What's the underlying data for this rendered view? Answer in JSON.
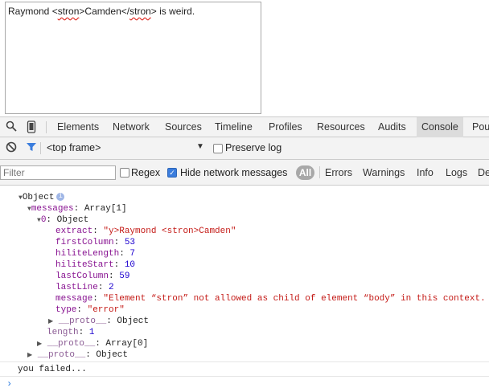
{
  "page": {
    "textarea": {
      "before": "Raymond <",
      "w1": "stron",
      "mid": ">Camden</",
      "w2": "stron",
      "after": "> is weird."
    }
  },
  "devtools": {
    "tabs": [
      "Elements",
      "Network",
      "Sources",
      "Timeline",
      "Profiles",
      "Resources",
      "Audits",
      "Console",
      "Pou"
    ],
    "active_tab": "Console",
    "frame": "<top frame>",
    "preserve_log": "Preserve log",
    "filter_placeholder": "Filter",
    "regex": "Regex",
    "hide_network": "Hide network messages",
    "levels": [
      "All",
      "Errors",
      "Warnings",
      "Info",
      "Logs",
      "De"
    ]
  },
  "console": {
    "object": "Object",
    "messages_key": "messages",
    "messages_val": "Array[1]",
    "item0_key": "0",
    "item0_val": "Object",
    "extract_key": "extract",
    "extract_val": "\"y>Raymond <stron>Camden\"",
    "firstColumn_key": "firstColumn",
    "firstColumn_val": "53",
    "hiliteLength_key": "hiliteLength",
    "hiliteLength_val": "7",
    "hiliteStart_key": "hiliteStart",
    "hiliteStart_val": "10",
    "lastColumn_key": "lastColumn",
    "lastColumn_val": "59",
    "lastLine_key": "lastLine",
    "lastLine_val": "2",
    "message_key": "message",
    "message_val": "\"Element “stron” not allowed as child of element “body” in this context.",
    "type_key": "type",
    "type_val": "\"error\"",
    "proto1_key": "__proto__",
    "proto1_val": "Object",
    "length_key": "length",
    "length_val": "1",
    "proto2_key": "__proto__",
    "proto2_val": "Array[0]",
    "proto3_key": "__proto__",
    "proto3_val": "Object",
    "log_text": "you failed..."
  }
}
